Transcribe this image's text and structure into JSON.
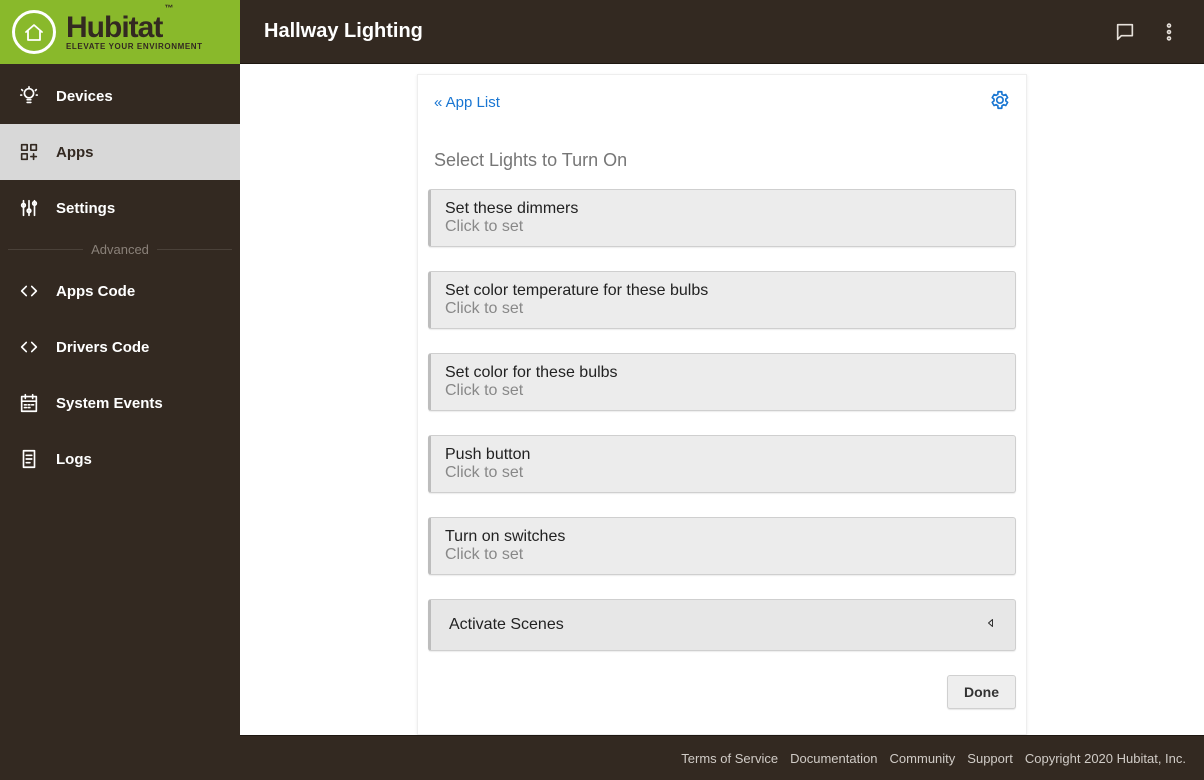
{
  "brand": {
    "name": "Hubitat",
    "tm": "™",
    "tagline": "ELEVATE YOUR ENVIRONMENT"
  },
  "header": {
    "title": "Hallway Lighting"
  },
  "sidebar": {
    "items": [
      {
        "label": "Devices"
      },
      {
        "label": "Apps"
      },
      {
        "label": "Settings"
      }
    ],
    "advanced_label": "Advanced",
    "advanced": [
      {
        "label": "Apps Code"
      },
      {
        "label": "Drivers Code"
      },
      {
        "label": "System Events"
      },
      {
        "label": "Logs"
      }
    ]
  },
  "panel": {
    "back": "« App List",
    "section_title": "Select Lights to Turn On",
    "options": [
      {
        "label": "Set these dimmers",
        "hint": "Click to set"
      },
      {
        "label": "Set color temperature for these bulbs",
        "hint": "Click to set"
      },
      {
        "label": "Set color for these bulbs",
        "hint": "Click to set"
      },
      {
        "label": "Push button",
        "hint": "Click to set"
      },
      {
        "label": "Turn on switches",
        "hint": "Click to set"
      }
    ],
    "accordion": {
      "label": "Activate Scenes"
    },
    "done": "Done"
  },
  "footer": {
    "links": [
      "Terms of Service",
      "Documentation",
      "Community",
      "Support"
    ],
    "copyright": "Copyright 2020 Hubitat, Inc."
  }
}
